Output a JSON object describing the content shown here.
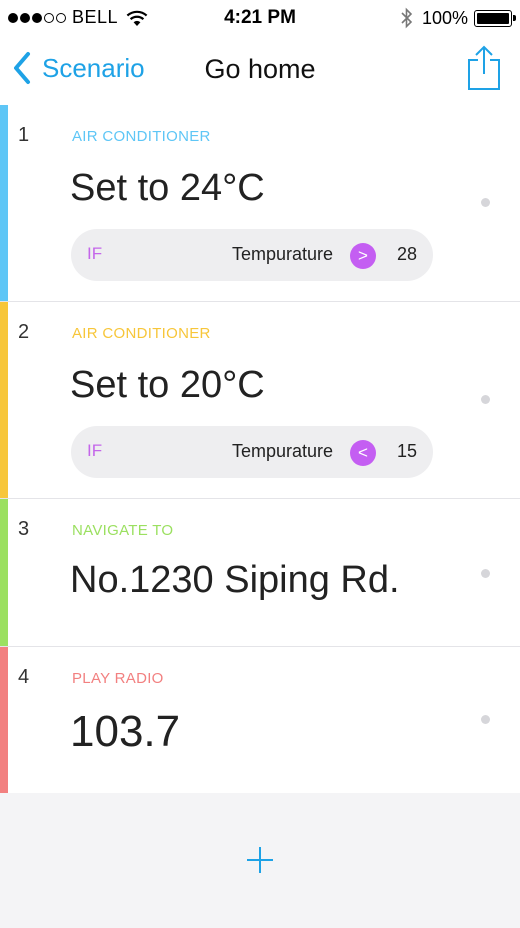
{
  "status": {
    "carrier": "BELL",
    "time": "4:21 PM",
    "battery": "100%",
    "battery_level": 1.0
  },
  "nav": {
    "back_label": "Scenario",
    "title": "Go home",
    "share_icon": "share-icon",
    "back_icon": "chevron-left-icon"
  },
  "colors": {
    "accent_blue": "#1ea2e6",
    "purple": "#c45ef2"
  },
  "steps": [
    {
      "index": "1",
      "category": "AIR CONDITIONER",
      "category_color": "#5ec6f6",
      "value": "Set to 24°C",
      "condition": {
        "if_label": "IF",
        "param": "Tempurature",
        "operator": ">",
        "value": "28"
      }
    },
    {
      "index": "2",
      "category": "AIR CONDITIONER",
      "category_color": "#f7c63a",
      "value": "Set to 20°C",
      "condition": {
        "if_label": "IF",
        "param": "Tempurature",
        "operator": "<",
        "value": "15"
      }
    },
    {
      "index": "3",
      "category": "NAVIGATE TO",
      "category_color": "#9be060",
      "value": "No.1230 Siping Rd."
    },
    {
      "index": "4",
      "category": "PLAY RADIO",
      "category_color": "#f28080",
      "value": "103.7"
    }
  ],
  "add_icon": "plus-icon"
}
